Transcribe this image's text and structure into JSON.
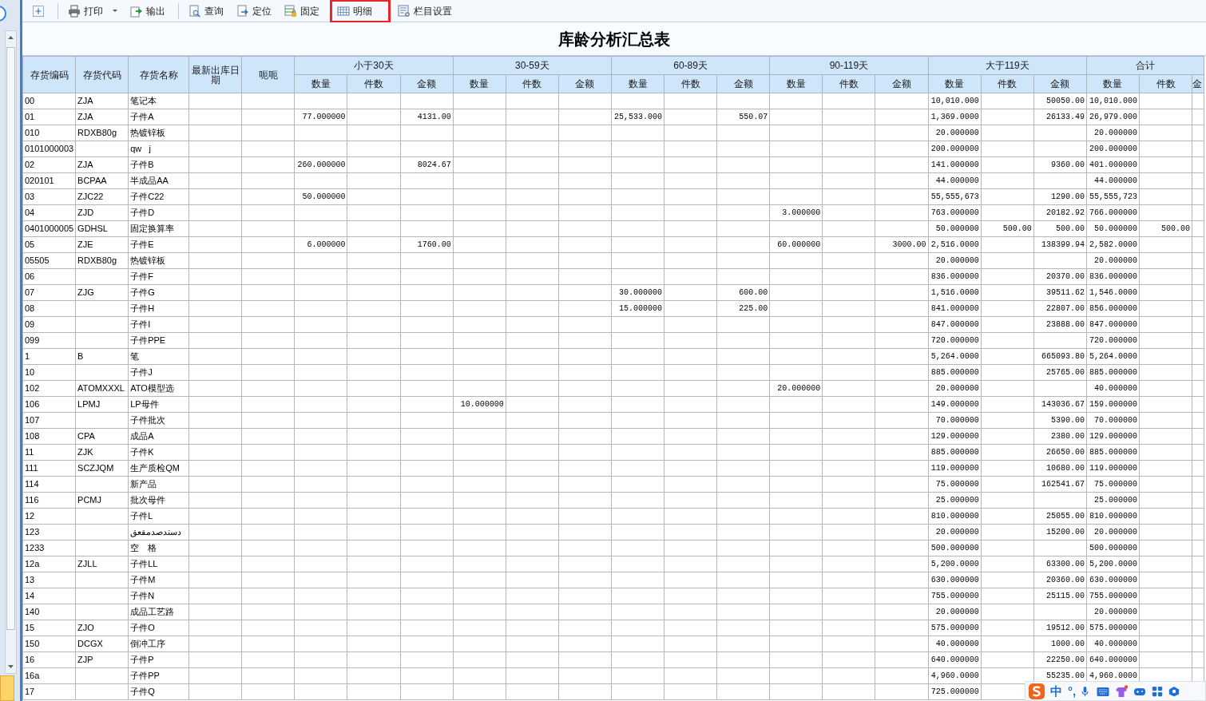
{
  "toolbar": [
    [
      {
        "kind": "add",
        "highlighted": false
      }
    ],
    [
      {
        "kind": "printer",
        "label": "打印",
        "dropdown": true,
        "highlighted": false
      },
      {
        "kind": "export",
        "label": "输出",
        "dropdown": false,
        "highlighted": false
      }
    ],
    [
      {
        "kind": "query",
        "label": "查询",
        "dropdown": false,
        "highlighted": false
      },
      {
        "kind": "locate",
        "label": "定位",
        "dropdown": false,
        "highlighted": false
      },
      {
        "kind": "lock",
        "label": "固定",
        "dropdown": false,
        "highlighted": false
      },
      {
        "kind": "detail",
        "label": "明细",
        "dropdown": false,
        "highlighted": true
      },
      {
        "kind": "columns",
        "label": "栏目设置",
        "dropdown": false,
        "highlighted": false
      }
    ]
  ],
  "report_title": "库龄分析汇总表",
  "table": {
    "fixed_columns": [
      "存货编码",
      "存货代码",
      "存货名称",
      "最新出库日期",
      "呃呃"
    ],
    "groups": [
      {
        "label": "小于30天",
        "subcolumns": [
          "数量",
          "件数",
          "金额"
        ]
      },
      {
        "label": "30-59天",
        "subcolumns": [
          "数量",
          "件数",
          "金额"
        ]
      },
      {
        "label": "60-89天",
        "subcolumns": [
          "数量",
          "件数",
          "金额"
        ]
      },
      {
        "label": "90-119天",
        "subcolumns": [
          "数量",
          "件数",
          "金额"
        ]
      },
      {
        "label": "大于119天",
        "subcolumns": [
          "数量",
          "件数",
          "金额"
        ]
      },
      {
        "label": "合计",
        "subcolumns": [
          "数量",
          "件数",
          "金"
        ]
      }
    ],
    "rows": [
      {
        "code": "00",
        "item_code": "ZJA",
        "name": "笔记本",
        "cells": {
          "gt119": {
            "qty": "10,010.000",
            "amt": "50050.00"
          },
          "total": {
            "qty": "10,010.000"
          }
        }
      },
      {
        "code": "01",
        "item_code": "ZJA",
        "name": "子件A",
        "cells": {
          "lt30": {
            "qty": "77.000000",
            "amt": "4131.00"
          },
          "d60": {
            "qty": "25,533.000",
            "amt": "550.07"
          },
          "gt119": {
            "qty": "1,369.0000",
            "amt": "26133.49"
          },
          "total": {
            "qty": "26,979.000"
          }
        }
      },
      {
        "code": "010",
        "item_code": "RDXB80g",
        "name": "热镀锌板",
        "cells": {
          "gt119": {
            "qty": "20.000000"
          },
          "total": {
            "qty": "20.000000"
          }
        }
      },
      {
        "code": "0101000003",
        "name": "qw   j",
        "cells": {
          "gt119": {
            "qty": "200.000000"
          },
          "total": {
            "qty": "200.000000"
          }
        }
      },
      {
        "code": "02",
        "item_code": "ZJA",
        "name": "子件B",
        "cells": {
          "lt30": {
            "qty": "260.000000",
            "amt": "8024.67"
          },
          "gt119": {
            "qty": "141.000000",
            "amt": "9360.00"
          },
          "total": {
            "qty": "401.000000"
          }
        }
      },
      {
        "code": "020101",
        "item_code": "BCPAA",
        "name": "半成品AA",
        "cells": {
          "gt119": {
            "qty": "44.000000"
          },
          "total": {
            "qty": "44.000000"
          }
        }
      },
      {
        "code": "03",
        "item_code": "ZJC22",
        "name": "子件C22",
        "cells": {
          "lt30": {
            "qty": "50.000000"
          },
          "gt119": {
            "qty": "55,555,673",
            "amt": "1290.00"
          },
          "total": {
            "qty": "55,555,723"
          }
        }
      },
      {
        "code": "04",
        "item_code": "ZJD",
        "name": "子件D",
        "cells": {
          "d90": {
            "qty": "3.000000"
          },
          "gt119": {
            "qty": "763.000000",
            "amt": "20182.92"
          },
          "total": {
            "qty": "766.000000"
          }
        }
      },
      {
        "code": "0401000005",
        "item_code": "GDHSL",
        "name": "固定换算率",
        "cells": {
          "gt119": {
            "qty": "50.000000",
            "pcs": "500.00",
            "amt": "500.00"
          },
          "total": {
            "qty": "50.000000",
            "pcs": "500.00"
          }
        }
      },
      {
        "code": "05",
        "item_code": "ZJE",
        "name": "子件E",
        "cells": {
          "lt30": {
            "qty": "6.000000",
            "amt": "1760.00"
          },
          "d90": {
            "qty": "60.000000",
            "amt": "3000.00"
          },
          "gt119": {
            "qty": "2,516.0000",
            "amt": "138399.94"
          },
          "total": {
            "qty": "2,582.0000"
          }
        }
      },
      {
        "code": "05505",
        "item_code": "RDXB80g",
        "name": "热镀锌板",
        "cells": {
          "gt119": {
            "qty": "20.000000"
          },
          "total": {
            "qty": "20.000000"
          }
        }
      },
      {
        "code": "06",
        "name": "子件F",
        "cells": {
          "gt119": {
            "qty": "836.000000",
            "amt": "20370.00"
          },
          "total": {
            "qty": "836.000000"
          }
        }
      },
      {
        "code": "07",
        "item_code": "ZJG",
        "name": "子件G",
        "cells": {
          "d60": {
            "qty": "30.000000",
            "amt": "600.00"
          },
          "gt119": {
            "qty": "1,516.0000",
            "amt": "39511.62"
          },
          "total": {
            "qty": "1,546.0000"
          }
        }
      },
      {
        "code": "08",
        "name": "子件H",
        "cells": {
          "d60": {
            "qty": "15.000000",
            "amt": "225.00"
          },
          "gt119": {
            "qty": "841.000000",
            "amt": "22807.00"
          },
          "total": {
            "qty": "856.000000"
          }
        }
      },
      {
        "code": "09",
        "name": "子件I",
        "cells": {
          "gt119": {
            "qty": "847.000000",
            "amt": "23888.00"
          },
          "total": {
            "qty": "847.000000"
          }
        }
      },
      {
        "code": "099",
        "name": "子件PPE",
        "cells": {
          "gt119": {
            "qty": "720.000000"
          },
          "total": {
            "qty": "720.000000"
          }
        }
      },
      {
        "code": "1",
        "item_code": "B",
        "name": "笔",
        "cells": {
          "gt119": {
            "qty": "5,264.0000",
            "amt": "665093.80"
          },
          "total": {
            "qty": "5,264.0000"
          }
        }
      },
      {
        "code": "10",
        "name": "子件J",
        "cells": {
          "gt119": {
            "qty": "885.000000",
            "amt": "25765.00"
          },
          "total": {
            "qty": "885.000000"
          }
        }
      },
      {
        "code": "102",
        "item_code": "ATOMXXXL",
        "name": "ATO模型选",
        "cells": {
          "d90": {
            "qty": "20.000000"
          },
          "gt119": {
            "qty": "20.000000"
          },
          "total": {
            "qty": "40.000000"
          }
        }
      },
      {
        "code": "106",
        "item_code": "LPMJ",
        "name": "LP母件",
        "cells": {
          "d30": {
            "qty": "10.000000"
          },
          "gt119": {
            "qty": "149.000000",
            "amt": "143036.67"
          },
          "total": {
            "qty": "159.000000"
          }
        }
      },
      {
        "code": "107",
        "name": "子件批次",
        "cells": {
          "gt119": {
            "qty": "70.000000",
            "amt": "5390.00"
          },
          "total": {
            "qty": "70.000000"
          }
        }
      },
      {
        "code": "108",
        "item_code": "CPA",
        "name": "成品A",
        "cells": {
          "gt119": {
            "qty": "129.000000",
            "amt": "2380.00"
          },
          "total": {
            "qty": "129.000000"
          }
        }
      },
      {
        "code": "11",
        "item_code": "ZJK",
        "name": "子件K",
        "cells": {
          "gt119": {
            "qty": "885.000000",
            "amt": "26650.00"
          },
          "total": {
            "qty": "885.000000"
          }
        }
      },
      {
        "code": "111",
        "item_code": "SCZJQM",
        "name": "生产质检QM",
        "cells": {
          "gt119": {
            "qty": "119.000000",
            "amt": "10680.00"
          },
          "total": {
            "qty": "119.000000"
          }
        }
      },
      {
        "code": "114",
        "name": "新产品",
        "cells": {
          "gt119": {
            "qty": "75.000000",
            "amt": "162541.67"
          },
          "total": {
            "qty": "75.000000"
          }
        }
      },
      {
        "code": "116",
        "item_code": "PCMJ",
        "name": "批次母件",
        "cells": {
          "gt119": {
            "qty": "25.000000"
          },
          "total": {
            "qty": "25.000000"
          }
        }
      },
      {
        "code": "12",
        "name": "子件L",
        "cells": {
          "gt119": {
            "qty": "810.000000",
            "amt": "25055.00"
          },
          "total": {
            "qty": "810.000000"
          }
        }
      },
      {
        "code": "123",
        "name": "دستدصدمقعق",
        "cells": {
          "gt119": {
            "qty": "20.000000",
            "amt": "15200.00"
          },
          "total": {
            "qty": "20.000000"
          }
        }
      },
      {
        "code": "1233",
        "name": "空　格",
        "cells": {
          "gt119": {
            "qty": "500.000000"
          },
          "total": {
            "qty": "500.000000"
          }
        }
      },
      {
        "code": "12a",
        "item_code": "ZJLL",
        "name": "子件LL",
        "cells": {
          "gt119": {
            "qty": "5,200.0000",
            "amt": "63300.00"
          },
          "total": {
            "qty": "5,200.0000"
          }
        }
      },
      {
        "code": "13",
        "name": "子件M",
        "cells": {
          "gt119": {
            "qty": "630.000000",
            "amt": "20360.00"
          },
          "total": {
            "qty": "630.000000"
          }
        }
      },
      {
        "code": "14",
        "name": "子件N",
        "cells": {
          "gt119": {
            "qty": "755.000000",
            "amt": "25115.00"
          },
          "total": {
            "qty": "755.000000"
          }
        }
      },
      {
        "code": "140",
        "name": "成品工艺路",
        "cells": {
          "gt119": {
            "qty": "20.000000"
          },
          "total": {
            "qty": "20.000000"
          }
        }
      },
      {
        "code": "15",
        "item_code": "ZJO",
        "name": "子件O",
        "cells": {
          "gt119": {
            "qty": "575.000000",
            "amt": "19512.00"
          },
          "total": {
            "qty": "575.000000"
          }
        }
      },
      {
        "code": "150",
        "item_code": "DCGX",
        "name": "倒冲工序",
        "cells": {
          "gt119": {
            "qty": "40.000000",
            "amt": "1000.00"
          },
          "total": {
            "qty": "40.000000"
          }
        }
      },
      {
        "code": "16",
        "item_code": "ZJP",
        "name": "子件P",
        "cells": {
          "gt119": {
            "qty": "640.000000",
            "amt": "22250.00"
          },
          "total": {
            "qty": "640.000000"
          }
        }
      },
      {
        "code": "16a",
        "name": "子件PP",
        "cells": {
          "gt119": {
            "qty": "4,960.0000",
            "amt": "55235.00"
          },
          "total": {
            "qty": "4,960.0000"
          }
        }
      },
      {
        "code": "17",
        "name": "子件Q",
        "cells": {
          "gt119": {
            "qty": "725.000000"
          }
        }
      }
    ]
  },
  "ime_bar": {
    "items": [
      {
        "kind": "logo"
      },
      {
        "kind": "text",
        "label": "中"
      },
      {
        "kind": "text",
        "label": "°,"
      },
      {
        "kind": "mic"
      },
      {
        "kind": "keyboard"
      },
      {
        "kind": "skin"
      },
      {
        "kind": "game"
      },
      {
        "kind": "apps"
      },
      {
        "kind": "tools"
      }
    ]
  }
}
